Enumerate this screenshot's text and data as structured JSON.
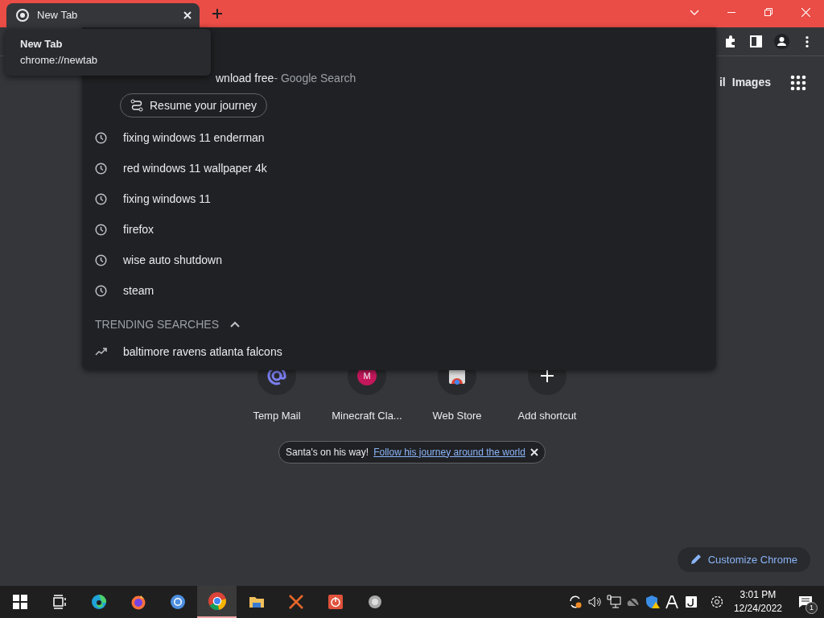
{
  "tab": {
    "title": "New Tab",
    "selected": true
  },
  "tooltip": {
    "title": "New Tab",
    "url": "chrome://newtab"
  },
  "top_links": [
    "il",
    "Images"
  ],
  "dropdown": {
    "partial_suggestion": {
      "text": "wnload free",
      "suffix": " - Google Search"
    },
    "journey_button": "Resume your journey",
    "history": [
      "fixing windows 11 enderman",
      "red windows 11 wallpaper 4k",
      "fixing windows 11",
      "firefox",
      "wise auto shutdown",
      "steam"
    ],
    "trending_header": "TRENDING SEARCHES",
    "trending_expanded": true,
    "trending": [
      "baltimore ravens atlanta falcons"
    ]
  },
  "shortcuts": [
    {
      "label": "Temp Mail",
      "kind": "at"
    },
    {
      "label": "Minecraft Cla...",
      "kind": "letter",
      "letter": "M"
    },
    {
      "label": "Web Store",
      "kind": "store"
    },
    {
      "label": "Add shortcut",
      "kind": "add"
    }
  ],
  "promo": {
    "text": "Santa's on his way!",
    "link": "Follow his journey around the world"
  },
  "customize_button": "Customize Chrome",
  "taskbar": {
    "apps": [
      {
        "kind": "start",
        "selected": false
      },
      {
        "kind": "taskview",
        "selected": false
      },
      {
        "kind": "edge",
        "selected": false
      },
      {
        "kind": "firefox",
        "selected": false
      },
      {
        "kind": "chromium",
        "selected": false
      },
      {
        "kind": "chrome",
        "selected": true
      },
      {
        "kind": "folder",
        "selected": false
      },
      {
        "kind": "xmark",
        "selected": false
      },
      {
        "kind": "power",
        "selected": false
      },
      {
        "kind": "speaker",
        "selected": false
      }
    ],
    "clock_time": "3:01 PM",
    "clock_date": "12/24/2022",
    "notification_count": "1"
  }
}
